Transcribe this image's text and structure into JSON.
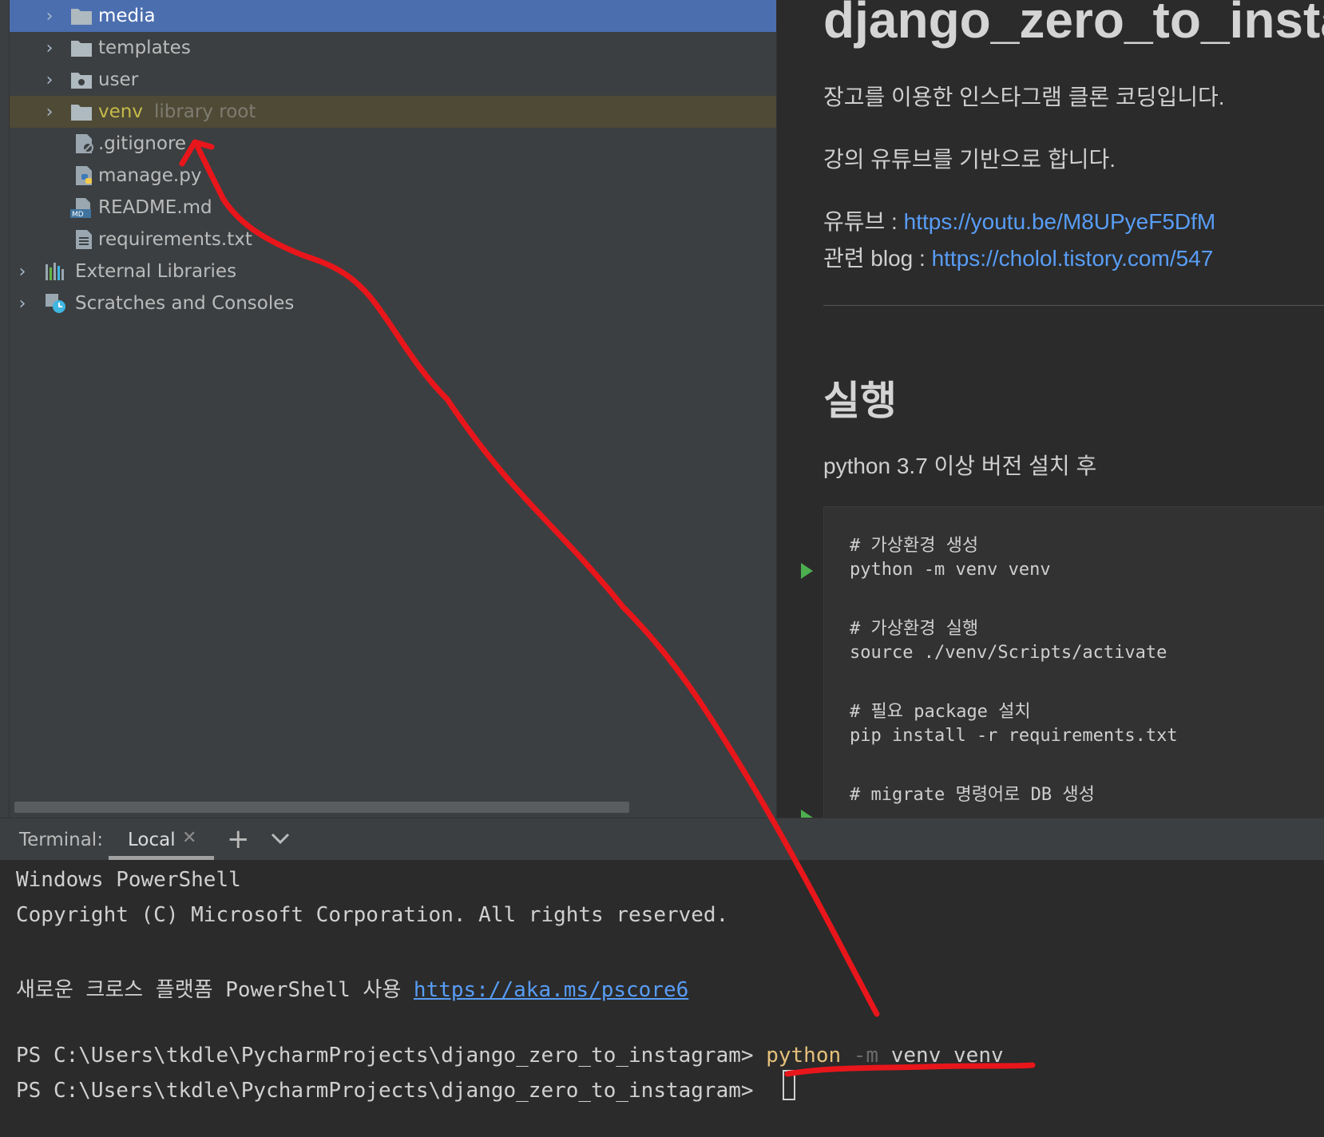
{
  "project_tree": {
    "items": [
      {
        "label": "media",
        "type": "folder",
        "selected": true
      },
      {
        "label": "templates",
        "type": "folder"
      },
      {
        "label": "user",
        "type": "package-folder"
      },
      {
        "label": "venv",
        "hint": "library root",
        "type": "folder",
        "excluded": true
      },
      {
        "label": ".gitignore",
        "type": "gitignore-file"
      },
      {
        "label": "manage.py",
        "type": "python-file"
      },
      {
        "label": "README.md",
        "type": "markdown-file"
      },
      {
        "label": "requirements.txt",
        "type": "text-file"
      },
      {
        "label": "External Libraries",
        "type": "libraries"
      },
      {
        "label": "Scratches and Consoles",
        "type": "scratches"
      }
    ]
  },
  "preview": {
    "title": "django_zero_to_insta",
    "intro": "장고를 이용한 인스타그램 클론 코딩입니다.",
    "based_on": "강의 유튜브를 기반으로 합니다.",
    "youtube_label": "유튜브 : ",
    "youtube_url": "https://youtu.be/M8UPyeF5DfM",
    "blog_label": "관련 blog : ",
    "blog_url": "https://cholol.tistory.com/547",
    "heading_run": "실행",
    "python_req": "python 3.7 이상 버전 설치 후",
    "code_lines": [
      "# 가상환경 생성",
      "python -m venv venv",
      "",
      "# 가상환경 실행",
      "source ./venv/Scripts/activate",
      "",
      "# 필요 package 설치",
      "pip install -r requirements.txt",
      "",
      "# migrate 명령어로 DB 생성"
    ]
  },
  "terminal": {
    "label": "Terminal:",
    "tab_name": "Local",
    "lines": {
      "l1": "Windows PowerShell",
      "l2": "Copyright (C) Microsoft Corporation. All rights reserved.",
      "l4_text": "새로운 크로스 플랫폼 PowerShell 사용 ",
      "l4_link": "https://aka.ms/pscore6",
      "prompt": "PS C:\\Users\\tkdle\\PycharmProjects\\django_zero_to_instagram> ",
      "cmd_python": "python",
      "cmd_flag": "-m",
      "cmd_args": "venv venv"
    }
  },
  "colors": {
    "selection": "#4b6eaf",
    "excluded_bg": "#4e4a36",
    "venv_text": "#c6b94a",
    "link": "#589df6",
    "annotation": "#e8161b"
  }
}
